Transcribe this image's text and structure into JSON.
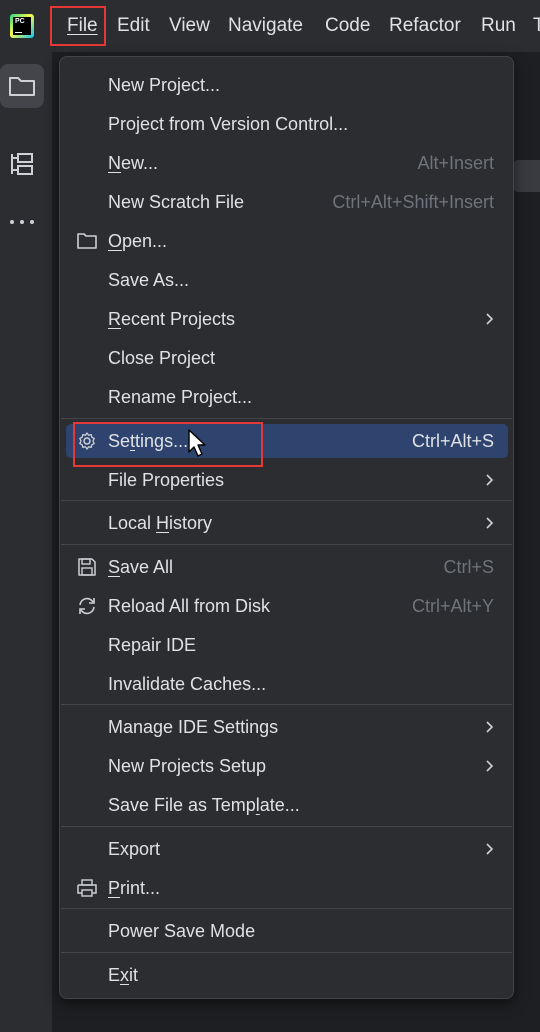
{
  "menubar": {
    "logo_text": "PC",
    "items": [
      "File",
      "Edit",
      "View",
      "Navigate",
      "Code",
      "Refactor",
      "Run",
      "T"
    ]
  },
  "menu": {
    "items": [
      {
        "label": "New Project...",
        "shortcut": "",
        "submenu": false,
        "icon": ""
      },
      {
        "label": "Project from Version Control...",
        "shortcut": "",
        "submenu": false,
        "icon": ""
      },
      {
        "label": "New...",
        "shortcut": "Alt+Insert",
        "submenu": false,
        "icon": ""
      },
      {
        "label": "New Scratch File",
        "shortcut": "Ctrl+Alt+Shift+Insert",
        "submenu": false,
        "icon": ""
      },
      {
        "label": "Open...",
        "shortcut": "",
        "submenu": false,
        "icon": "folder-icon"
      },
      {
        "label": "Save As...",
        "shortcut": "",
        "submenu": false,
        "icon": ""
      },
      {
        "label": "Recent Projects",
        "shortcut": "",
        "submenu": true,
        "icon": ""
      },
      {
        "label": "Close Project",
        "shortcut": "",
        "submenu": false,
        "icon": ""
      },
      {
        "label": "Rename Project...",
        "shortcut": "",
        "submenu": false,
        "icon": ""
      },
      {
        "label": "Settings...",
        "shortcut": "Ctrl+Alt+S",
        "submenu": false,
        "icon": "gear-icon",
        "selected": true
      },
      {
        "label": "File Properties",
        "shortcut": "",
        "submenu": true,
        "icon": ""
      },
      {
        "label": "Local History",
        "shortcut": "",
        "submenu": true,
        "icon": ""
      },
      {
        "label": "Save All",
        "shortcut": "Ctrl+S",
        "submenu": false,
        "icon": "save-icon"
      },
      {
        "label": "Reload All from Disk",
        "shortcut": "Ctrl+Alt+Y",
        "submenu": false,
        "icon": "reload-icon"
      },
      {
        "label": "Repair IDE",
        "shortcut": "",
        "submenu": false,
        "icon": ""
      },
      {
        "label": "Invalidate Caches...",
        "shortcut": "",
        "submenu": false,
        "icon": ""
      },
      {
        "label": "Manage IDE Settings",
        "shortcut": "",
        "submenu": true,
        "icon": ""
      },
      {
        "label": "New Projects Setup",
        "shortcut": "",
        "submenu": true,
        "icon": ""
      },
      {
        "label": "Save File as Template...",
        "shortcut": "",
        "submenu": false,
        "icon": ""
      },
      {
        "label": "Export",
        "shortcut": "",
        "submenu": true,
        "icon": ""
      },
      {
        "label": "Print...",
        "shortcut": "",
        "submenu": false,
        "icon": "print-icon"
      },
      {
        "label": "Power Save Mode",
        "shortcut": "",
        "submenu": false,
        "icon": ""
      },
      {
        "label": "Exit",
        "shortcut": "",
        "submenu": false,
        "icon": ""
      }
    ]
  },
  "colors": {
    "background": "#2b2d30",
    "selection": "#2e436e",
    "highlight_outline": "#e53935",
    "text": "#dfe1e5",
    "shortcut_text": "#6f737a"
  }
}
